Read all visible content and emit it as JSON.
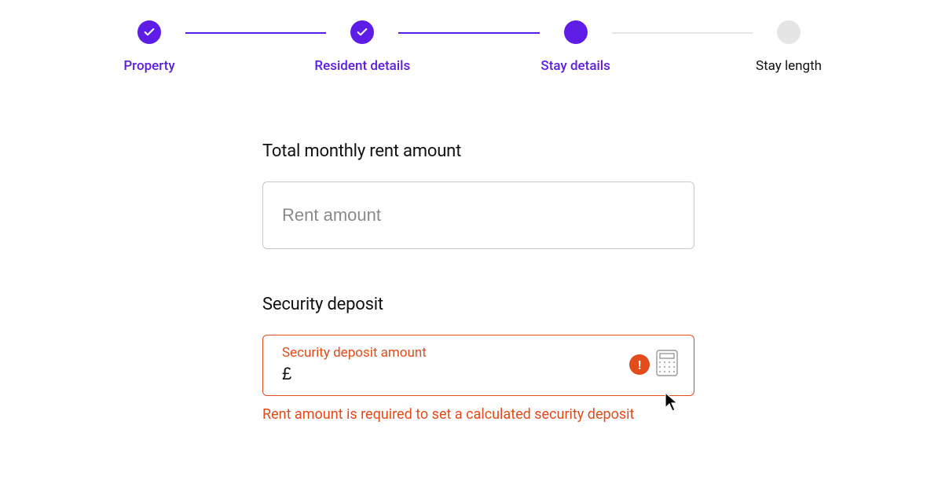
{
  "stepper": {
    "steps": [
      {
        "label": "Property",
        "state": "completed"
      },
      {
        "label": "Resident details",
        "state": "completed"
      },
      {
        "label": "Stay details",
        "state": "current"
      },
      {
        "label": "Stay length",
        "state": "pending"
      }
    ]
  },
  "form": {
    "rent": {
      "label": "Total monthly rent amount",
      "placeholder": "Rent amount",
      "value": ""
    },
    "deposit": {
      "label": "Security deposit",
      "floating_label": "Security deposit amount",
      "currency_symbol": "£",
      "error_message": "Rent amount is required to set a calculated security deposit"
    }
  },
  "icons": {
    "check": "check-icon",
    "error": "exclamation-icon",
    "calculator": "calculator-icon"
  }
}
